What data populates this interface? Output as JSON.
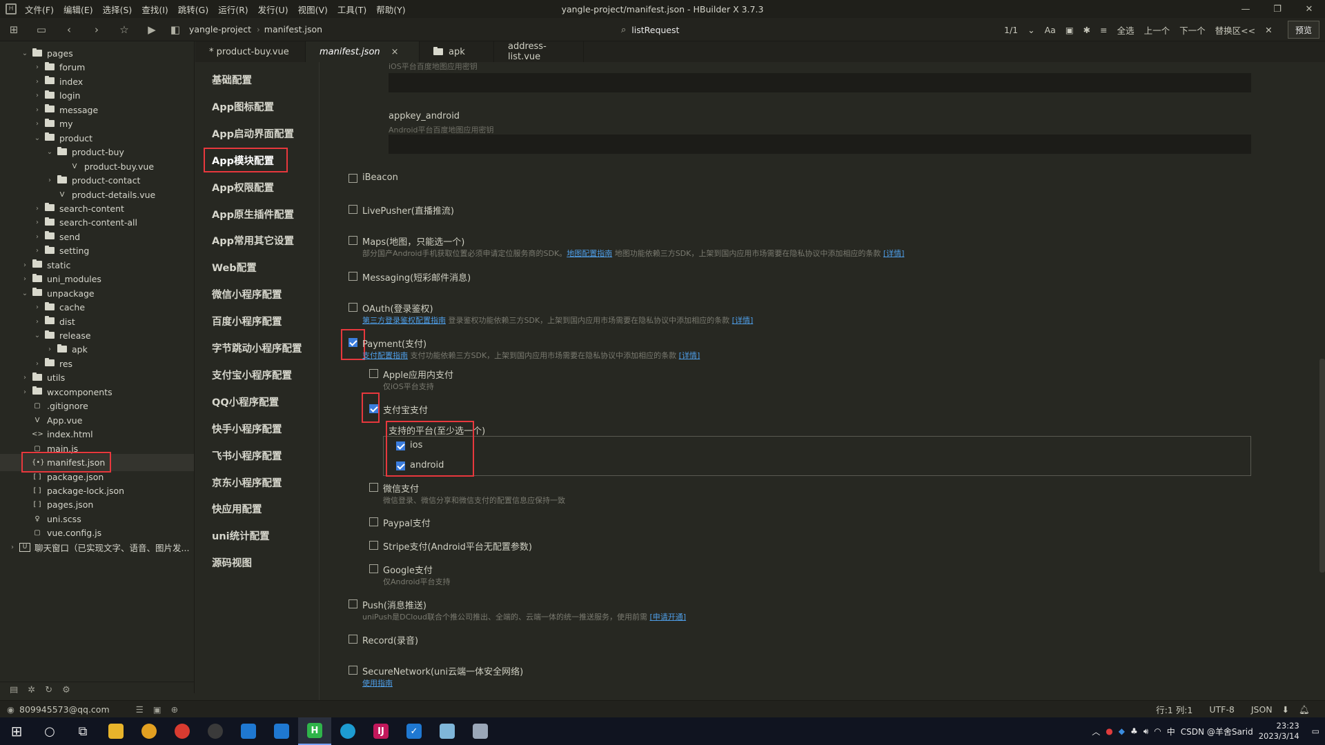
{
  "window": {
    "title": "yangle-project/manifest.json - HBuilder X 3.7.3",
    "menus": [
      "文件(F)",
      "编辑(E)",
      "选择(S)",
      "查找(I)",
      "跳转(G)",
      "运行(R)",
      "发行(U)",
      "视图(V)",
      "工具(T)",
      "帮助(Y)"
    ],
    "controls": [
      "—",
      "❐",
      "✕"
    ]
  },
  "toolbar": {
    "breadcrumb": [
      "yangle-project",
      "manifest.json"
    ],
    "search_text": "listRequest",
    "match_count": "1/1",
    "case_label": "Aa",
    "select_all": "全选",
    "prev": "上一个",
    "next": "下一个",
    "replace": "替换区<<",
    "preview": "预览"
  },
  "file_tree": [
    {
      "label": "pages",
      "depth": 1,
      "type": "folder",
      "open": true
    },
    {
      "label": "forum",
      "depth": 2,
      "type": "folder"
    },
    {
      "label": "index",
      "depth": 2,
      "type": "folder"
    },
    {
      "label": "login",
      "depth": 2,
      "type": "folder"
    },
    {
      "label": "message",
      "depth": 2,
      "type": "folder"
    },
    {
      "label": "my",
      "depth": 2,
      "type": "folder"
    },
    {
      "label": "product",
      "depth": 2,
      "type": "folder",
      "open": true
    },
    {
      "label": "product-buy",
      "depth": 3,
      "type": "folder",
      "open": true
    },
    {
      "label": "product-buy.vue",
      "depth": 4,
      "type": "file",
      "icon": "V"
    },
    {
      "label": "product-contact",
      "depth": 3,
      "type": "folder"
    },
    {
      "label": "product-details.vue",
      "depth": 3,
      "type": "file",
      "icon": "V"
    },
    {
      "label": "search-content",
      "depth": 2,
      "type": "folder"
    },
    {
      "label": "search-content-all",
      "depth": 2,
      "type": "folder"
    },
    {
      "label": "send",
      "depth": 2,
      "type": "folder"
    },
    {
      "label": "setting",
      "depth": 2,
      "type": "folder"
    },
    {
      "label": "static",
      "depth": 1,
      "type": "folder"
    },
    {
      "label": "uni_modules",
      "depth": 1,
      "type": "folder"
    },
    {
      "label": "unpackage",
      "depth": 1,
      "type": "folder",
      "open": true
    },
    {
      "label": "cache",
      "depth": 2,
      "type": "folder"
    },
    {
      "label": "dist",
      "depth": 2,
      "type": "folder"
    },
    {
      "label": "release",
      "depth": 2,
      "type": "folder",
      "open": true
    },
    {
      "label": "apk",
      "depth": 3,
      "type": "folder"
    },
    {
      "label": "res",
      "depth": 2,
      "type": "folder"
    },
    {
      "label": "utils",
      "depth": 1,
      "type": "folder"
    },
    {
      "label": "wxcomponents",
      "depth": 1,
      "type": "folder"
    },
    {
      "label": ".gitignore",
      "depth": 1,
      "type": "file",
      "icon": "▢"
    },
    {
      "label": "App.vue",
      "depth": 1,
      "type": "file",
      "icon": "V"
    },
    {
      "label": "index.html",
      "depth": 1,
      "type": "file",
      "icon": "<>"
    },
    {
      "label": "main.js",
      "depth": 1,
      "type": "file",
      "icon": "▢"
    },
    {
      "label": "manifest.json",
      "depth": 1,
      "type": "file",
      "icon": "{•}",
      "selected": true
    },
    {
      "label": "package.json",
      "depth": 1,
      "type": "file",
      "icon": "[ ]"
    },
    {
      "label": "package-lock.json",
      "depth": 1,
      "type": "file",
      "icon": "[ ]"
    },
    {
      "label": "pages.json",
      "depth": 1,
      "type": "file",
      "icon": "[ ]"
    },
    {
      "label": "uni.scss",
      "depth": 1,
      "type": "file",
      "icon": "♀"
    },
    {
      "label": "vue.config.js",
      "depth": 1,
      "type": "file",
      "icon": "▢"
    },
    {
      "label": "聊天窗口（已实现文字、语音、图片发...",
      "depth": 0,
      "type": "project",
      "icon": "U"
    }
  ],
  "tabs": [
    {
      "label": "* product-buy.vue",
      "active": false
    },
    {
      "label": "manifest.json",
      "active": true,
      "close": "×"
    },
    {
      "label": "apk",
      "active": false
    },
    {
      "label": "address-list.vue",
      "active": false
    }
  ],
  "config_nav": [
    "基础配置",
    "App图标配置",
    "App启动界面配置",
    "App模块配置",
    "App权限配置",
    "App原生插件配置",
    "App常用其它设置",
    "Web配置",
    "微信小程序配置",
    "百度小程序配置",
    "字节跳动小程序配置",
    "支付宝小程序配置",
    "QQ小程序配置",
    "快手小程序配置",
    "飞书小程序配置",
    "京东小程序配置",
    "快应用配置",
    "uni统计配置",
    "源码视图"
  ],
  "content": {
    "ios_hint": "iOS平台百度地图应用密钥",
    "appkey_android_label": "appkey_android",
    "appkey_android_hint": "Android平台百度地图应用密钥",
    "modules": {
      "ibeacon": "iBeacon",
      "livepusher": "LivePusher(直播推流)",
      "maps": "Maps(地图，只能选一个)",
      "maps_desc": "部分国产Android手机获取位置必须申请定位服务商的SDK。",
      "maps_link": "地图配置指南",
      "maps_desc2": " 地图功能依赖三方SDK，上架到国内应用市场需要在隐私协议中添加相应的条款 ",
      "maps_detail": "[详情]",
      "messaging": "Messaging(短彩邮件消息)",
      "oauth": "OAuth(登录鉴权)",
      "oauth_link": "第三方登录鉴权配置指南",
      "oauth_desc": " 登录鉴权功能依赖三方SDK，上架到国内应用市场需要在隐私协议中添加相应的条款 ",
      "oauth_detail": "[详情]",
      "payment": "Payment(支付)",
      "payment_link": "支付配置指南",
      "payment_desc": " 支付功能依赖三方SDK，上架到国内应用市场需要在隐私协议中添加相应的条款 ",
      "payment_detail": "[详情]",
      "apple_pay": "Apple应用内支付",
      "apple_pay_desc": "仅iOS平台支持",
      "alipay": "支付宝支付",
      "platforms_title": "支持的平台(至少选一个)",
      "ios": "ios",
      "android": "android",
      "wechat_pay": "微信支付",
      "wechat_pay_desc": "微信登录、微信分享和微信支付的配置信息应保持一致",
      "paypal": "Paypal支付",
      "stripe": "Stripe支付(Android平台无配置参数)",
      "google_pay": "Google支付",
      "google_pay_desc": "仅Android平台支持",
      "push": "Push(消息推送)",
      "push_desc": "uniPush是DCloud联合个推公司推出、全端的、云端一体的统一推送服务，使用前需 ",
      "push_link": "[申请开通]",
      "record": "Record(录音)",
      "securenetwork": "SecureNetwork(uni云端一体安全网络)",
      "securenetwork_link": "使用指南"
    }
  },
  "statusbar": {
    "account": "809945573@qq.com",
    "position": "行:1  列:1",
    "encoding": "UTF-8",
    "language": "JSON"
  },
  "taskbar": {
    "time": "23:23",
    "date": "2023/3/14",
    "ime": "中",
    "watermark": "CSDN @羊舍Sarid"
  }
}
